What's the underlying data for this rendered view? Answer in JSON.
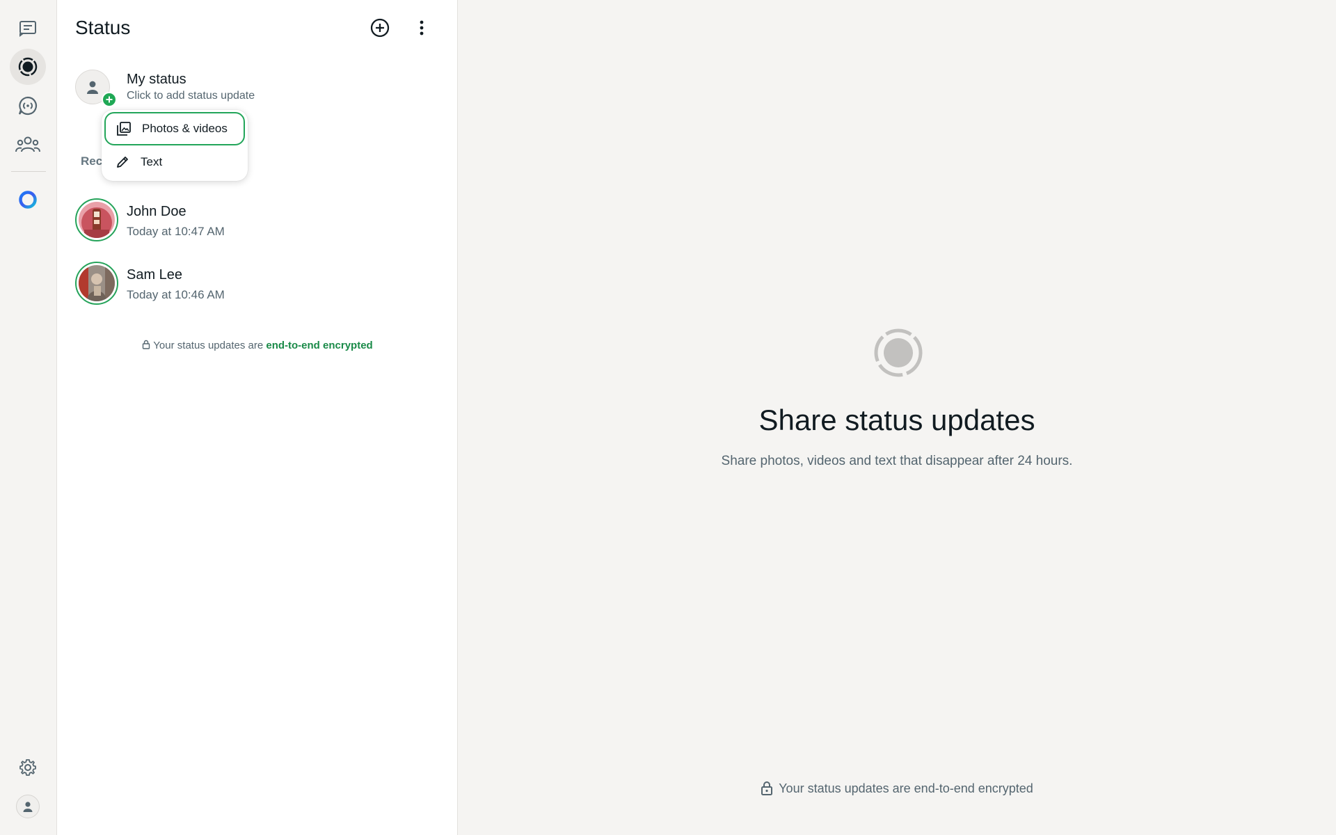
{
  "rail": {
    "items": [
      {
        "name": "chats",
        "icon": "chats-icon"
      },
      {
        "name": "status",
        "icon": "status-icon",
        "active": true
      },
      {
        "name": "channels",
        "icon": "channels-icon"
      },
      {
        "name": "communities",
        "icon": "communities-icon"
      },
      {
        "name": "meta-ai",
        "icon": "meta-ai-icon"
      }
    ],
    "bottom": [
      {
        "name": "settings",
        "icon": "gear-icon"
      },
      {
        "name": "profile",
        "icon": "avatar-icon"
      }
    ]
  },
  "panel": {
    "title": "Status",
    "my_status": {
      "name": "My status",
      "subtitle": "Click to add status update"
    },
    "section_label": "Rec",
    "contacts": [
      {
        "name": "John Doe",
        "time": "Today at 10:47 AM"
      },
      {
        "name": "Sam Lee",
        "time": "Today at 10:46 AM"
      }
    ],
    "e2e": {
      "prefix": "Your status updates are ",
      "link": "end-to-end encrypted"
    }
  },
  "menu": {
    "items": [
      {
        "label": "Photos & videos",
        "icon": "photos-icon",
        "focused": true
      },
      {
        "label": "Text",
        "icon": "pencil-icon"
      }
    ]
  },
  "main": {
    "title": "Share status updates",
    "subtitle": "Share photos, videos and text that disappear after 24 hours.",
    "footer": "Your status updates are end-to-end encrypted"
  },
  "colors": {
    "accent": "#1fa855",
    "ring": "#25a35a",
    "link": "#1a8a48"
  }
}
